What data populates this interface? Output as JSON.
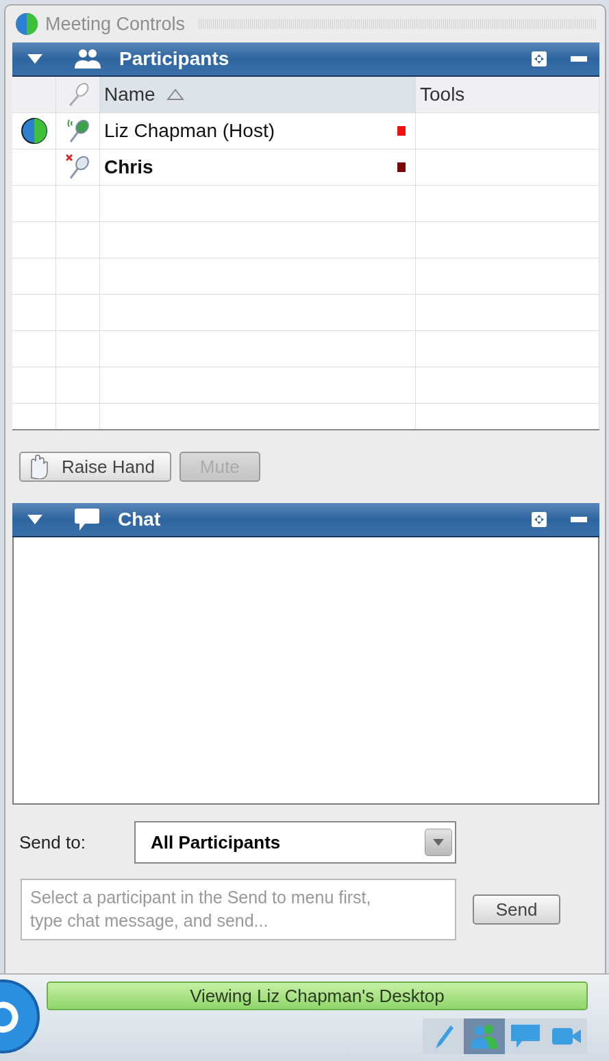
{
  "window": {
    "title": "Meeting Controls"
  },
  "participants_panel": {
    "title": "Participants",
    "columns": [
      {
        "label": "Name",
        "sorted": true
      },
      {
        "label": "Tools",
        "sorted": false
      }
    ],
    "rows": [
      {
        "name": "Liz Chapman (Host)",
        "presenter": true,
        "muted": false,
        "bold": false,
        "color": "#ee1111"
      },
      {
        "name": "Chris",
        "presenter": false,
        "muted": true,
        "bold": true,
        "color": "#7a0a0a"
      }
    ],
    "buttons": [
      {
        "kind": "raise-hand",
        "label": "Raise Hand",
        "disabled": false
      },
      {
        "kind": "mute",
        "label": "Mute",
        "disabled": true
      }
    ]
  },
  "chat_panel": {
    "title": "Chat",
    "send_to_label": "Send to:",
    "send_to_value": "All Participants",
    "message_placeholder": "Select a participant in the Send to menu first, type chat message, and send...",
    "send_button": "Send"
  },
  "status_bar": {
    "text": "Viewing Liz Chapman's Desktop"
  },
  "toolbar": [
    {
      "kind": "pen",
      "selected": false
    },
    {
      "kind": "participants",
      "selected": true
    },
    {
      "kind": "chat",
      "selected": false
    },
    {
      "kind": "video",
      "selected": false
    }
  ]
}
